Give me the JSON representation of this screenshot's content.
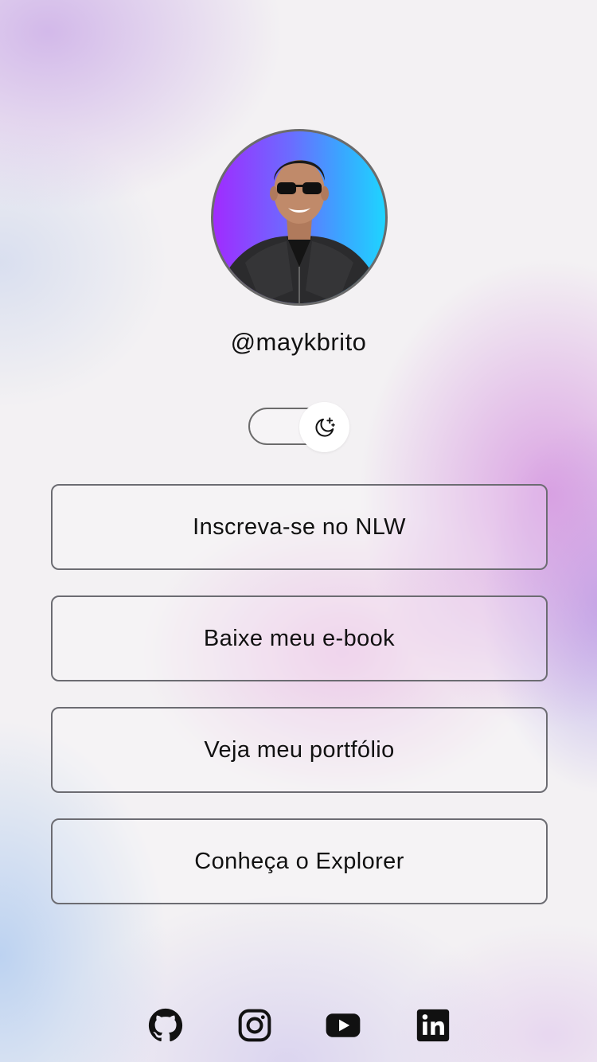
{
  "profile": {
    "username": "@maykbrito",
    "avatar_description_icon": "profile-photo"
  },
  "theme_switch": {
    "icon": "moon-stars-icon",
    "state": "light"
  },
  "links": [
    {
      "label": "Inscreva-se no NLW"
    },
    {
      "label": "Baixe meu e-book"
    },
    {
      "label": "Veja meu portfólio"
    },
    {
      "label": "Conheça o Explorer"
    }
  ],
  "social": [
    {
      "name": "github-icon"
    },
    {
      "name": "instagram-icon"
    },
    {
      "name": "youtube-icon"
    },
    {
      "name": "linkedin-icon"
    }
  ],
  "colors": {
    "text": "#111111",
    "border": "#6c6c72",
    "avatar_gradient_start": "#a02bff",
    "avatar_gradient_end": "#1fd4ff"
  }
}
